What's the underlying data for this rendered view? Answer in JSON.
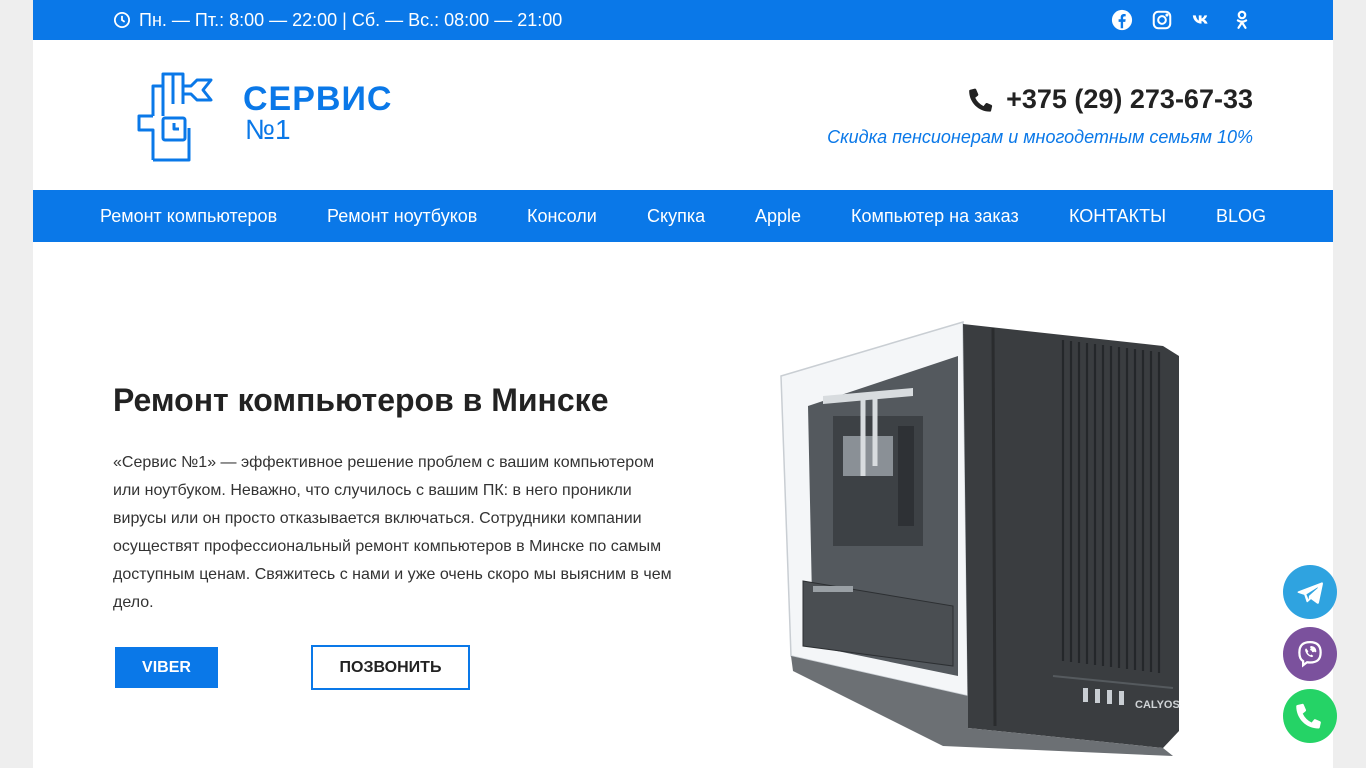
{
  "topbar": {
    "hours": "Пн. — Пт.: 8:00 — 22:00 | Сб. — Вс.: 08:00 — 21:00",
    "socials": [
      "facebook-icon",
      "instagram-icon",
      "vk-icon",
      "odnoklassniki-icon"
    ]
  },
  "header": {
    "logo_line1": "СЕРВИС",
    "logo_line2": "№1",
    "phone": "+375 (29) 273-67-33",
    "discount": "Скидка пенсионерам и многодетным семьям 10%"
  },
  "nav": {
    "items": [
      "Ремонт компьютеров",
      "Ремонт ноутбуков",
      "Консоли",
      "Скупка",
      "Apple",
      "Компьютер на заказ",
      "КОНТАКТЫ",
      "BLOG"
    ]
  },
  "hero": {
    "title": "Ремонт компьютеров в Минске",
    "text": "«Сервис №1» — эффективное решение проблем с вашим компьютером или ноутбуком. Неважно, что случилось с вашим ПК: в него проникли вирусы или он просто отказывается включаться. Сотрудники компании осуществят профессиональный ремонт компьютеров в Минске по самым доступным ценам. Свяжитесь с нами и уже очень скоро мы выясним в чем дело.",
    "viber_label": "VIBER",
    "call_label": "ПОЗВОНИТЬ",
    "image_brand": "CALYOS"
  },
  "colors": {
    "brand": "#0a78e8",
    "telegram": "#2fa3e0",
    "viber": "#7b519d",
    "whatsapp": "#25d366"
  }
}
